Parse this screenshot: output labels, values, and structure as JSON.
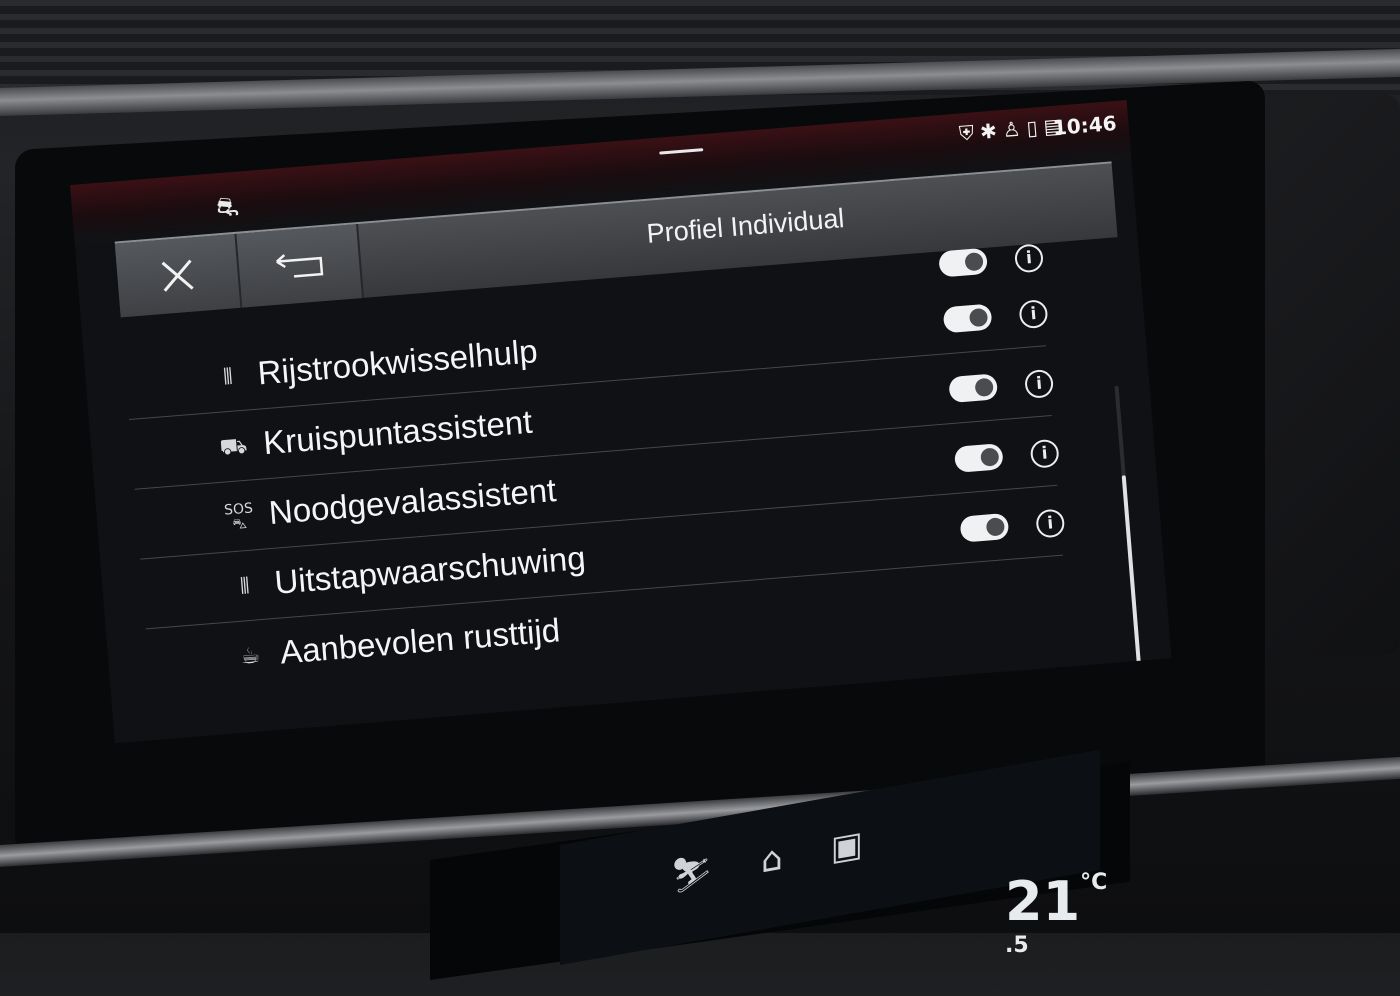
{
  "statusbar": {
    "time": "10:46",
    "left_icon": "car-sync-icon",
    "right_icons": [
      "shield-car-icon",
      "bluetooth-icon",
      "profile-icon",
      "phone-icon",
      "signal-icon"
    ]
  },
  "header": {
    "title": "Profiel Individual",
    "close_icon": "close-icon",
    "back_icon": "return-arrow-icon"
  },
  "settings": [
    {
      "label": "",
      "icon": "",
      "toggle": "on"
    },
    {
      "label": "Rijstrookwisselhulp",
      "icon": "lane-change-icon",
      "toggle": "on"
    },
    {
      "label": "Kruispuntassistent",
      "icon": "crossing-car-icon",
      "toggle": "on"
    },
    {
      "label": "Noodgevalassistent",
      "icon": "sos-car-icon",
      "sos_text": "SOS",
      "toggle": "on"
    },
    {
      "label": "Uitstapwaarschuwing",
      "icon": "exit-warning-icon",
      "toggle": "on"
    },
    {
      "label": "Aanbevolen rusttijd",
      "icon": "coffee-cup-icon"
    }
  ],
  "climate": {
    "temperature_whole": "21",
    "temperature_decimal": ".5",
    "unit": "°C"
  },
  "colors": {
    "accent_red": "#d4223a",
    "background": "#0f1114",
    "header": "#45474b",
    "text": "#f4f5f6"
  }
}
